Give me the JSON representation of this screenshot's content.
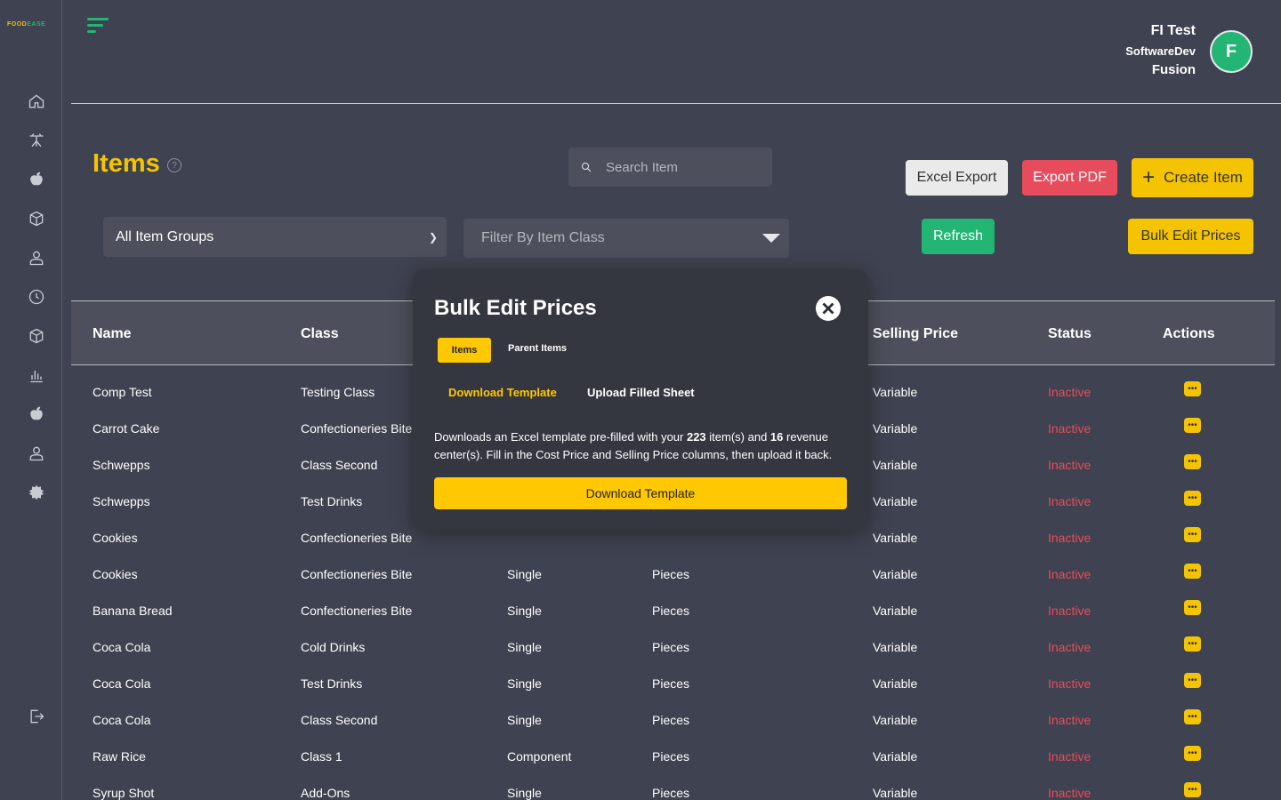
{
  "brand": {
    "logo_a": "FOOD",
    "logo_b": "EASE",
    "accent": "#f5c400",
    "green": "#22b573"
  },
  "sidebar": {
    "items": [
      {
        "icon": "home-icon"
      },
      {
        "icon": "table-icon"
      },
      {
        "icon": "food-icon"
      },
      {
        "icon": "box-icon"
      },
      {
        "icon": "user-icon"
      },
      {
        "icon": "clock-icon"
      },
      {
        "icon": "package-icon"
      },
      {
        "icon": "chart-icon"
      },
      {
        "icon": "fruit-icon"
      },
      {
        "icon": "person-icon"
      },
      {
        "icon": "settings-icon"
      }
    ],
    "logout_icon": "logout-icon"
  },
  "header": {
    "user_name": "FI Test",
    "user_company": "SoftwareDev",
    "user_location": "Fusion",
    "avatar_initial": "F"
  },
  "toolbar": {
    "title": "Items",
    "search_placeholder": "Search Item",
    "excel_label": "Excel Export",
    "pdf_label": "Export PDF",
    "create_label": "Create Item",
    "refresh_label": "Refresh",
    "bulk_label": "Bulk Edit Prices",
    "group_select": "All Item Groups",
    "class_placeholder": "Filter By Item Class"
  },
  "table": {
    "headers": {
      "name": "Name",
      "class": "Class",
      "selling": "Selling Price",
      "status": "Status",
      "actions": "Actions"
    },
    "rows": [
      {
        "name": "Comp Test",
        "class": "Testing Class",
        "type": "",
        "unit": "",
        "price": "Variable",
        "status": "Inactive"
      },
      {
        "name": "Carrot Cake",
        "class": "Confectioneries Bite",
        "type": "",
        "unit": "",
        "price": "Variable",
        "status": "Inactive"
      },
      {
        "name": "Schwepps",
        "class": "Class Second",
        "type": "",
        "unit": "",
        "price": "Variable",
        "status": "Inactive"
      },
      {
        "name": "Schwepps",
        "class": "Test Drinks",
        "type": "",
        "unit": "",
        "price": "Variable",
        "status": "Inactive"
      },
      {
        "name": "Cookies",
        "class": "Confectioneries Bite",
        "type": "",
        "unit": "",
        "price": "Variable",
        "status": "Inactive"
      },
      {
        "name": "Cookies",
        "class": "Confectioneries Bite",
        "type": "Single",
        "unit": "Pieces",
        "price": "Variable",
        "status": "Inactive"
      },
      {
        "name": "Banana Bread",
        "class": "Confectioneries Bite",
        "type": "Single",
        "unit": "Pieces",
        "price": "Variable",
        "status": "Inactive"
      },
      {
        "name": "Coca Cola",
        "class": "Cold Drinks",
        "type": "Single",
        "unit": "Pieces",
        "price": "Variable",
        "status": "Inactive"
      },
      {
        "name": "Coca Cola",
        "class": "Test Drinks",
        "type": "Single",
        "unit": "Pieces",
        "price": "Variable",
        "status": "Inactive"
      },
      {
        "name": "Coca Cola",
        "class": "Class Second",
        "type": "Single",
        "unit": "Pieces",
        "price": "Variable",
        "status": "Inactive"
      },
      {
        "name": "Raw Rice",
        "class": "Class 1",
        "type": "Component",
        "unit": "Pieces",
        "price": "Variable",
        "status": "Inactive"
      },
      {
        "name": "Syrup Shot",
        "class": "Add-Ons",
        "type": "Single",
        "unit": "Pieces",
        "price": "Variable",
        "status": "Inactive"
      }
    ]
  },
  "modal": {
    "title": "Bulk Edit Prices",
    "tab_items": "Items",
    "tab_parent": "Parent Items",
    "sub_download": "Download Template",
    "sub_upload": "Upload Filled Sheet",
    "text_1": "Downloads an Excel template pre-filled with your ",
    "item_count": "223",
    "text_2": " item(s) and ",
    "center_count": "16",
    "text_3": " revenue center(s). Fill in the Cost Price and Selling Price columns, then upload it back.",
    "button_label": "Download Template"
  }
}
